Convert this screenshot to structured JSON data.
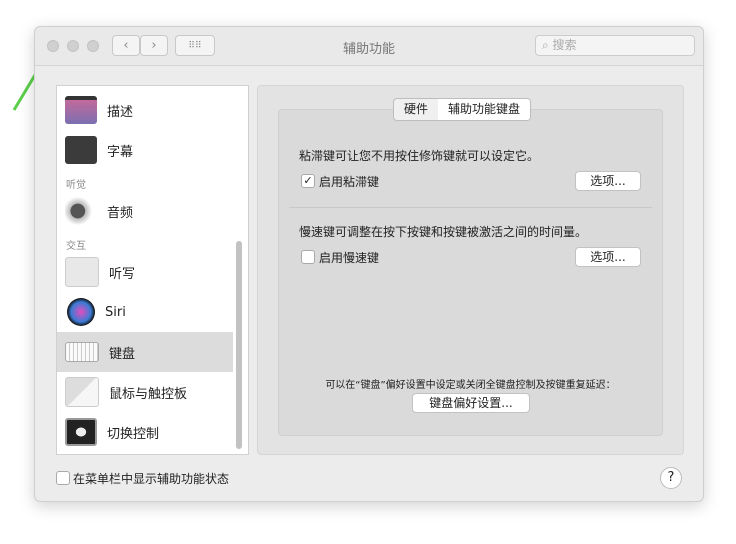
{
  "window": {
    "title": "辅助功能",
    "search_placeholder": "搜索"
  },
  "sidebar": {
    "items": [
      {
        "label": "描述",
        "icon": "descriptions-icon"
      },
      {
        "label": "字幕",
        "icon": "captions-icon"
      },
      {
        "label": "音频",
        "icon": "audio-icon"
      },
      {
        "label": "听写",
        "icon": "dictation-icon"
      },
      {
        "label": "Siri",
        "icon": "siri-icon"
      },
      {
        "label": "键盘",
        "icon": "keyboard-icon",
        "selected": true
      },
      {
        "label": "鼠标与触控板",
        "icon": "mouse-icon"
      },
      {
        "label": "切换控制",
        "icon": "switch-control-icon"
      }
    ],
    "sections": [
      "听觉",
      "交互"
    ]
  },
  "tabs": [
    "硬件",
    "辅助功能键盘"
  ],
  "sticky": {
    "description": "粘滞键可让您不用按住修饰键就可以设定它。",
    "checkbox": "启用粘滞键",
    "checked": true,
    "options": "选项..."
  },
  "slow": {
    "description": "慢速键可调整在按下按键和按键被激活之间的时间量。",
    "checkbox": "启用慢速键",
    "checked": false,
    "options": "选项..."
  },
  "footer_note": "可以在“键盘”偏好设置中设定或关闭全键盘控制及按键重复延迟：",
  "keyboard_prefs_button": "键盘偏好设置...",
  "menubar_checkbox": "在菜单栏中显示辅助功能状态",
  "help": "?"
}
